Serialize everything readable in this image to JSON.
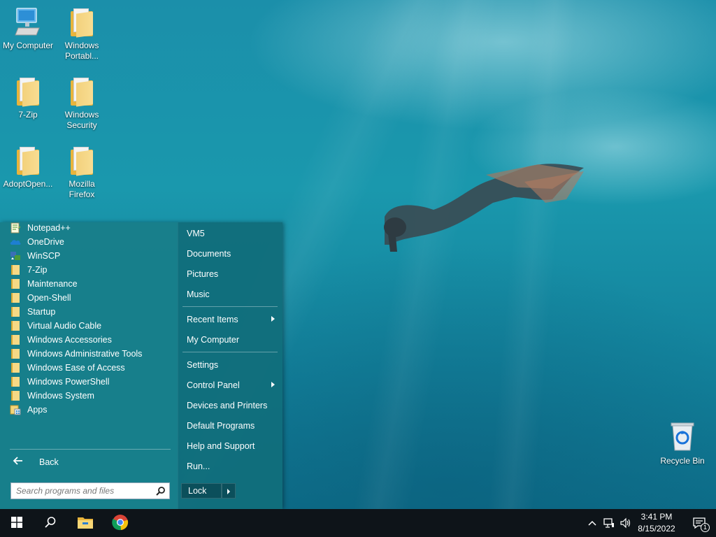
{
  "desktop": {
    "icons": [
      {
        "label": "My Computer",
        "icon": "computer-icon"
      },
      {
        "label": "Windows Portabl...",
        "icon": "folder-icon"
      },
      {
        "label": "7-Zip",
        "icon": "folder-icon"
      },
      {
        "label": "Windows Security",
        "icon": "folder-icon"
      },
      {
        "label": "AdoptOpen...",
        "icon": "folder-icon"
      },
      {
        "label": "Mozilla Firefox",
        "icon": "folder-icon"
      }
    ],
    "recycle_bin": {
      "label": "Recycle Bin",
      "icon": "recycle-bin-icon"
    }
  },
  "start_menu": {
    "programs": [
      {
        "label": "Notepad++",
        "icon": "notepad-plus-plus-icon"
      },
      {
        "label": "OneDrive",
        "icon": "onedrive-cloud-icon"
      },
      {
        "label": "WinSCP",
        "icon": "winscp-icon"
      },
      {
        "label": "7-Zip",
        "icon": "folder-icon"
      },
      {
        "label": "Maintenance",
        "icon": "folder-icon"
      },
      {
        "label": "Open-Shell",
        "icon": "folder-icon"
      },
      {
        "label": "Startup",
        "icon": "folder-icon"
      },
      {
        "label": "Virtual Audio Cable",
        "icon": "folder-icon"
      },
      {
        "label": "Windows Accessories",
        "icon": "folder-icon"
      },
      {
        "label": "Windows Administrative Tools",
        "icon": "folder-icon"
      },
      {
        "label": "Windows Ease of Access",
        "icon": "folder-icon"
      },
      {
        "label": "Windows PowerShell",
        "icon": "folder-icon"
      },
      {
        "label": "Windows System",
        "icon": "folder-icon"
      },
      {
        "label": "Apps",
        "icon": "apps-icon"
      }
    ],
    "back_label": "Back",
    "search_placeholder": "Search programs and files",
    "right_items": {
      "user": "VM5",
      "documents": "Documents",
      "pictures": "Pictures",
      "music": "Music",
      "recent_items": "Recent Items",
      "my_computer": "My Computer",
      "settings": "Settings",
      "control_panel": "Control Panel",
      "devices_printers": "Devices and Printers",
      "default_programs": "Default Programs",
      "help_support": "Help and Support",
      "run": "Run..."
    },
    "lock_label": "Lock"
  },
  "taskbar": {
    "time": "3:41 PM",
    "date": "8/15/2022",
    "notification_count": "1"
  }
}
